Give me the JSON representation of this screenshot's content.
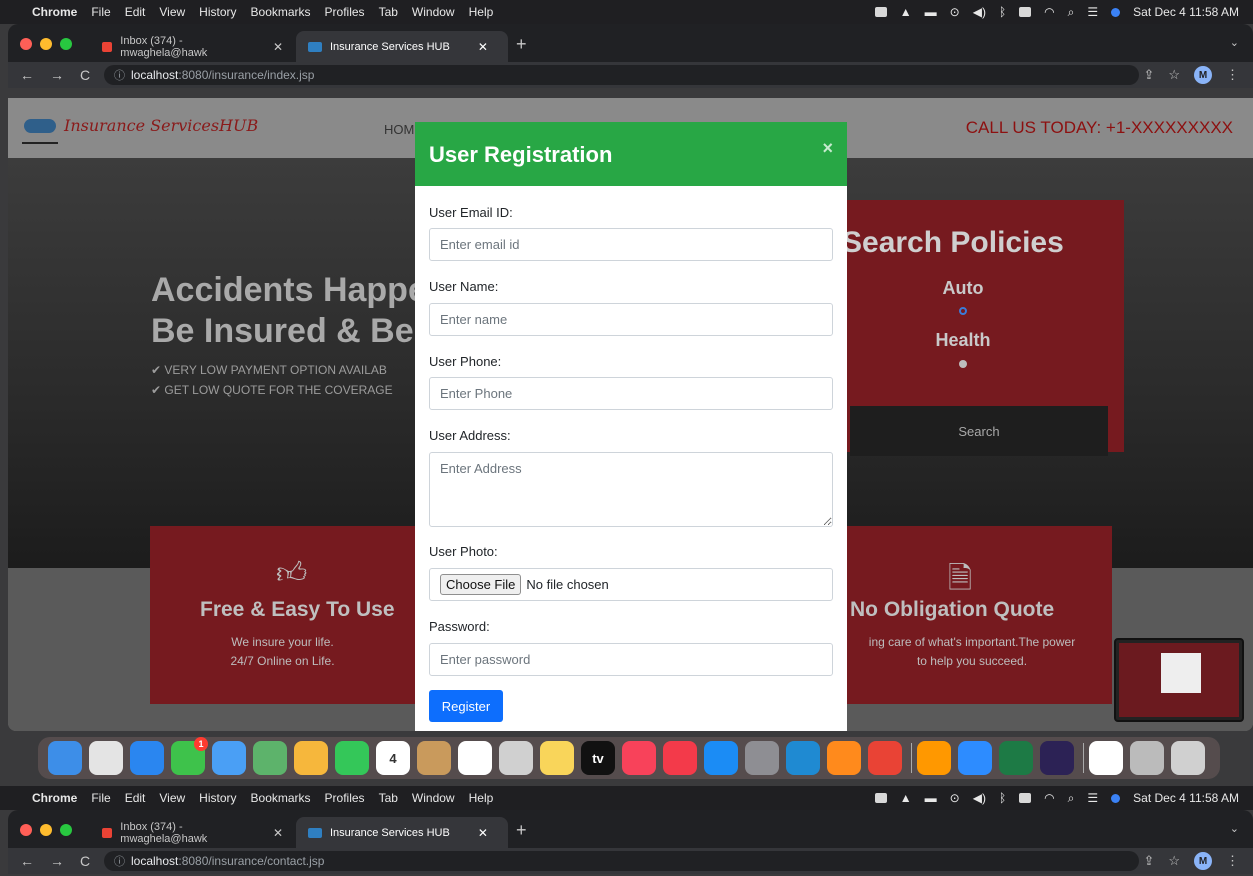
{
  "menubar": {
    "app": "Chrome",
    "menus": [
      "File",
      "Edit",
      "View",
      "History",
      "Bookmarks",
      "Profiles",
      "Tab",
      "Window",
      "Help"
    ],
    "datetime": "Sat Dec 4  11:58 AM"
  },
  "tabs": [
    {
      "title": "Inbox (374) - mwaghela@hawk",
      "icon": "gmail-icon",
      "active": false
    },
    {
      "title": "Insurance Services HUB",
      "icon": "site-favicon",
      "active": true
    }
  ],
  "address": {
    "top": {
      "host": "localhost",
      "path": ":8080/insurance/index.jsp"
    },
    "bottom": {
      "host": "localhost",
      "path": ":8080/insurance/contact.jsp"
    },
    "avatar": "M"
  },
  "site": {
    "logo_text": "Insurance ServicesHUB",
    "nav_link": "HOM",
    "call_us": "CALL US TODAY: +1-XXXXXXXXX",
    "hero_line1": "Accidents Happe",
    "hero_line2": "Be Insured & Be A",
    "bullet1": "✔ VERY LOW PAYMENT OPTION AVAILAB",
    "bullet2": "✔ GET LOW QUOTE FOR THE COVERAGE",
    "search": {
      "title": "Search Policies",
      "options": [
        "Auto",
        "Health"
      ],
      "button": "Search"
    },
    "card_left": {
      "title": "Free & Easy To Use",
      "line1": "We insure your life.",
      "line2": "24/7 Online on Life.",
      "icon": "thumbs-up-icon"
    },
    "card_right": {
      "title": "No Obligation Quote",
      "line1": "ing care of what's important.The power",
      "line2": "to help you succeed.",
      "icon": "document-icon"
    }
  },
  "modal": {
    "title": "User Registration",
    "close": "×",
    "email_label": "User Email ID:",
    "email_placeholder": "Enter email id",
    "name_label": "User Name:",
    "name_placeholder": "Enter name",
    "phone_label": "User Phone:",
    "phone_placeholder": "Enter Phone",
    "address_label": "User Address:",
    "address_placeholder": "Enter Address",
    "photo_label": "User Photo:",
    "file_button": "Choose File",
    "file_status": "No file chosen",
    "password_label": "Password:",
    "password_placeholder": "Enter password",
    "register": "Register"
  },
  "dock": {
    "apps": [
      {
        "name": "finder-icon",
        "color": "#3d8ee8"
      },
      {
        "name": "launchpad-icon",
        "color": "#e4e4e4"
      },
      {
        "name": "safari-icon",
        "color": "#2a86f0"
      },
      {
        "name": "messages-icon",
        "color": "#3ec24b",
        "badge": "1"
      },
      {
        "name": "mail-icon",
        "color": "#4a9ff5"
      },
      {
        "name": "maps-icon",
        "color": "#5db36b"
      },
      {
        "name": "photos-icon",
        "color": "#f6b73c"
      },
      {
        "name": "facetime-icon",
        "color": "#34c759"
      },
      {
        "name": "calendar-icon",
        "color": "#ffffff",
        "label": "4"
      },
      {
        "name": "contacts-icon",
        "color": "#c99a5c"
      },
      {
        "name": "reminders-icon",
        "color": "#ffffff"
      },
      {
        "name": "screenshot-icon",
        "color": "#d0d0d0"
      },
      {
        "name": "notes-icon",
        "color": "#f9d55a"
      },
      {
        "name": "tv-icon",
        "color": "#111111",
        "label": "tv"
      },
      {
        "name": "music-icon",
        "color": "#f8425a"
      },
      {
        "name": "news-icon",
        "color": "#f33a4a"
      },
      {
        "name": "app-store-icon",
        "color": "#1b8cf5"
      },
      {
        "name": "system-preferences-icon",
        "color": "#8e8e93"
      },
      {
        "name": "vscode-icon",
        "color": "#1f8ad2"
      },
      {
        "name": "firefox-icon",
        "color": "#ff8a1c"
      },
      {
        "name": "chrome-icon",
        "color": "#e94335"
      },
      {
        "name": "sublime-icon",
        "color": "#ff9800"
      },
      {
        "name": "zoom-icon",
        "color": "#2d8cff"
      },
      {
        "name": "excel-icon",
        "color": "#1d7a45"
      },
      {
        "name": "eclipse-icon",
        "color": "#2c2255"
      },
      {
        "name": "preview-doc-icon",
        "color": "#ffffff"
      },
      {
        "name": "downloads-icon",
        "color": "#bbbbbb"
      },
      {
        "name": "trash-icon",
        "color": "#d0d0d0"
      }
    ]
  }
}
